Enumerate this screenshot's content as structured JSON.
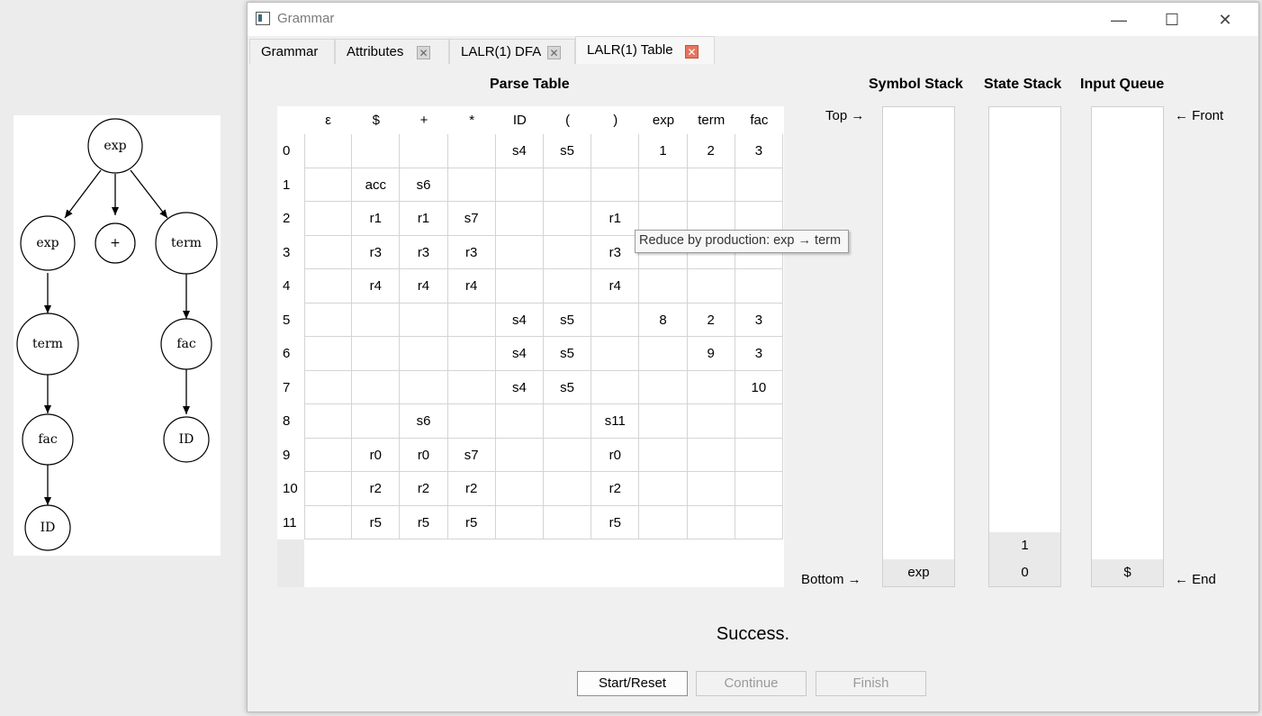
{
  "tree": {
    "nodes": [
      {
        "id": "n-exp-root",
        "label": "exp"
      },
      {
        "id": "n-exp-left",
        "label": "exp"
      },
      {
        "id": "n-plus",
        "label": "+"
      },
      {
        "id": "n-term-right",
        "label": "term"
      },
      {
        "id": "n-term-left",
        "label": "term"
      },
      {
        "id": "n-fac-right",
        "label": "fac"
      },
      {
        "id": "n-fac-left",
        "label": "fac"
      },
      {
        "id": "n-id-right",
        "label": "ID"
      },
      {
        "id": "n-id-left",
        "label": "ID"
      }
    ]
  },
  "window": {
    "title": "Grammar",
    "min_icon": "minimize-icon",
    "max_icon": "maximize-icon",
    "close_icon": "close-icon"
  },
  "tabs": [
    {
      "label": "Grammar",
      "closable": false,
      "active": false
    },
    {
      "label": "Attributes",
      "closable": true,
      "active": false
    },
    {
      "label": "LALR(1) DFA",
      "closable": true,
      "active": false
    },
    {
      "label": "LALR(1) Table",
      "closable": true,
      "active": true
    }
  ],
  "headers": {
    "parse_table": "Parse Table",
    "symbol_stack": "Symbol Stack",
    "state_stack": "State Stack",
    "input_queue": "Input Queue"
  },
  "side_labels": {
    "top": "Top →",
    "bottom": "Bottom →",
    "front": "← Front",
    "end": "← End"
  },
  "parse_table": {
    "columns": [
      "ε",
      "$",
      "+",
      "*",
      "ID",
      "(",
      ")",
      "exp",
      "term",
      "fac"
    ],
    "rows": [
      {
        "state": "0",
        "cells": [
          "",
          "",
          "",
          "",
          "s4",
          "s5",
          "",
          "1",
          "2",
          "3"
        ]
      },
      {
        "state": "1",
        "cells": [
          "",
          "acc",
          "s6",
          "",
          "",
          "",
          "",
          "",
          "",
          ""
        ]
      },
      {
        "state": "2",
        "cells": [
          "",
          "r1",
          "r1",
          "s7",
          "",
          "",
          "r1",
          "",
          "",
          ""
        ]
      },
      {
        "state": "3",
        "cells": [
          "",
          "r3",
          "r3",
          "r3",
          "",
          "",
          "r3",
          "",
          "",
          ""
        ]
      },
      {
        "state": "4",
        "cells": [
          "",
          "r4",
          "r4",
          "r4",
          "",
          "",
          "r4",
          "",
          "",
          ""
        ]
      },
      {
        "state": "5",
        "cells": [
          "",
          "",
          "",
          "",
          "s4",
          "s5",
          "",
          "8",
          "2",
          "3"
        ]
      },
      {
        "state": "6",
        "cells": [
          "",
          "",
          "",
          "",
          "s4",
          "s5",
          "",
          "",
          "9",
          "3"
        ]
      },
      {
        "state": "7",
        "cells": [
          "",
          "",
          "",
          "",
          "s4",
          "s5",
          "",
          "",
          "",
          "10"
        ]
      },
      {
        "state": "8",
        "cells": [
          "",
          "",
          "s6",
          "",
          "",
          "",
          "s11",
          "",
          "",
          ""
        ]
      },
      {
        "state": "9",
        "cells": [
          "",
          "r0",
          "r0",
          "s7",
          "",
          "",
          "r0",
          "",
          "",
          ""
        ]
      },
      {
        "state": "10",
        "cells": [
          "",
          "r2",
          "r2",
          "r2",
          "",
          "",
          "r2",
          "",
          "",
          ""
        ]
      },
      {
        "state": "11",
        "cells": [
          "",
          "r5",
          "r5",
          "r5",
          "",
          "",
          "r5",
          "",
          "",
          ""
        ]
      }
    ]
  },
  "tooltip": "Reduce by production: exp → term",
  "symbol_stack": [
    "exp"
  ],
  "state_stack": [
    "1",
    "0"
  ],
  "input_queue": [
    "$"
  ],
  "status": "Success.",
  "buttons": {
    "start_reset": "Start/Reset",
    "continue": "Continue",
    "finish": "Finish"
  }
}
